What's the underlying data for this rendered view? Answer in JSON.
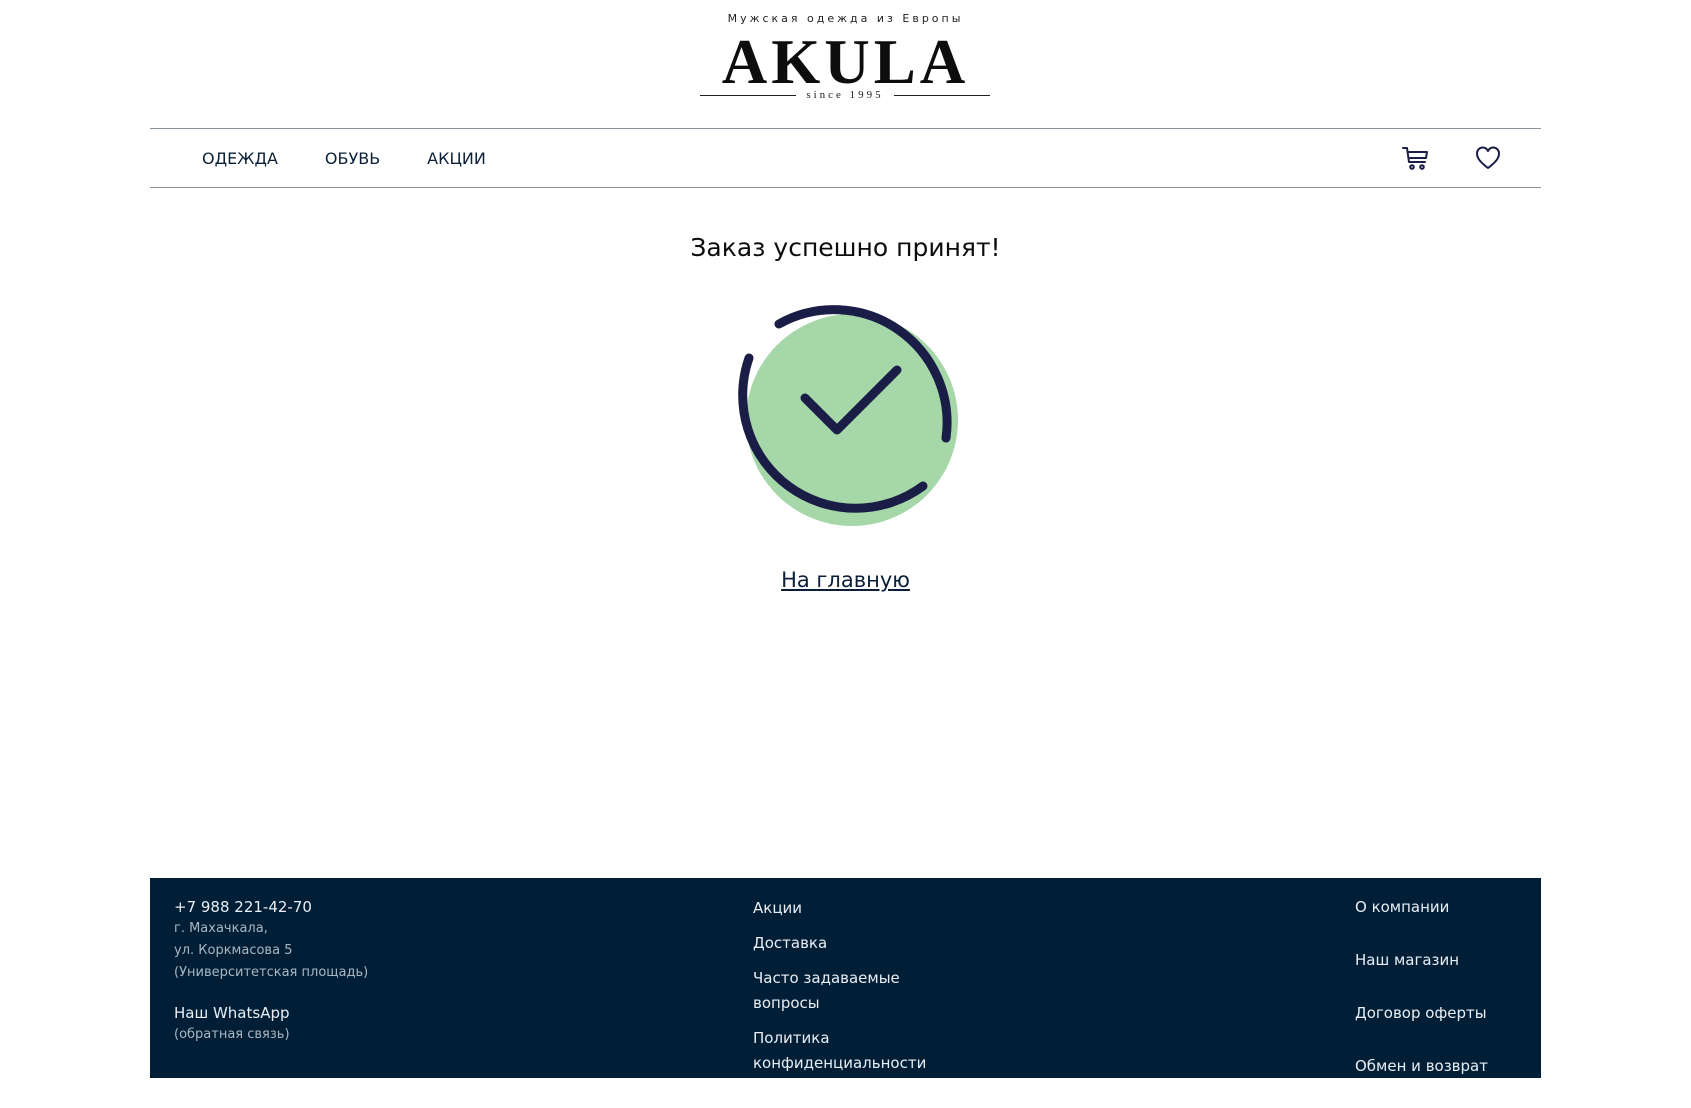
{
  "header": {
    "tagline": "Мужская одежда из Европы",
    "brand": "AKULA",
    "since": "since 1995"
  },
  "nav": {
    "items": [
      {
        "label": "ОДЕЖДА"
      },
      {
        "label": "ОБУВЬ"
      },
      {
        "label": "АКЦИИ"
      }
    ],
    "icons": [
      "cart-icon",
      "heart-icon"
    ]
  },
  "main": {
    "title": "Заказ успешно принят!",
    "home_link": "На главную",
    "icon": "success-check-icon"
  },
  "footer": {
    "contact": {
      "phone": "+7 988 221-42-70",
      "address_line1": "г. Махачкала,",
      "address_line2": "ул. Коркмасова 5",
      "address_line3": "(Университетская площадь)",
      "whatsapp": "Наш WhatsApp",
      "whatsapp_note": "(обратная связь)"
    },
    "links_mid": [
      "Акции",
      "Доставка",
      "Часто задаваемые вопросы",
      "Политика конфиденциальности"
    ],
    "links_right": [
      "О компании",
      "Наш магазин",
      "Договор оферты",
      "Обмен и возврат"
    ]
  },
  "colors": {
    "navy": "#001f37",
    "check_green": "#a6d7a8",
    "check_dark": "#1a1d45"
  }
}
